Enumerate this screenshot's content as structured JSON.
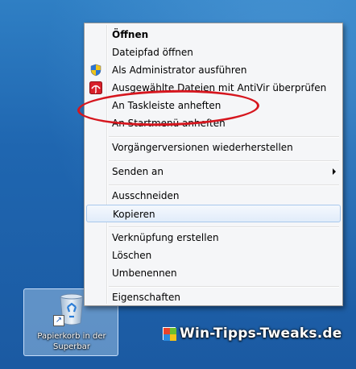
{
  "menu": {
    "items": [
      {
        "label": "Öffnen",
        "bold": true
      },
      {
        "label": "Dateipfad öffnen"
      },
      {
        "label": "Als Administrator ausführen",
        "icon": "uac-shield-icon"
      },
      {
        "label": "Ausgewählte Dateien mit AntiVir überprüfen",
        "icon": "antivir-umbrella-icon"
      },
      {
        "label": "An Taskleiste anheften"
      },
      {
        "label": "An Startmenü anheften"
      },
      {
        "label": "Vorgängerversionen wiederherstellen"
      },
      {
        "label": "Senden an",
        "submenu": true
      },
      {
        "label": "Ausschneiden"
      },
      {
        "label": "Kopieren",
        "highlighted": true
      },
      {
        "label": "Verknüpfung erstellen"
      },
      {
        "label": "Löschen"
      },
      {
        "label": "Umbenennen"
      },
      {
        "label": "Eigenschaften"
      }
    ]
  },
  "annotation": {
    "color": "#d6161e",
    "target": "An Taskleiste anheften"
  },
  "desktop_icon": {
    "label": "Papierkorb in der Superbar",
    "icon": "recycle-bin-icon",
    "selected": true
  },
  "watermark": {
    "text": "Win-Tipps-Tweaks.de",
    "icon": "windows-logo-icon"
  },
  "colors": {
    "desktop": "#1f66b0",
    "menu_background": "#f5f6f8",
    "highlight_border": "#a8c8ec",
    "annotation": "#d6161e"
  }
}
